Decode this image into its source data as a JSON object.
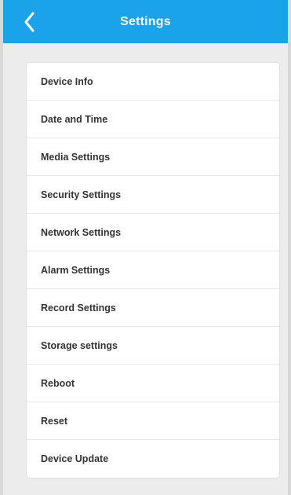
{
  "header": {
    "title": "Settings",
    "back_icon": "chevron-left-icon",
    "background_color": "#1aa3e8"
  },
  "menu": {
    "items": [
      {
        "label": "Device Info"
      },
      {
        "label": "Date and Time"
      },
      {
        "label": "Media Settings"
      },
      {
        "label": "Security Settings"
      },
      {
        "label": "Network Settings"
      },
      {
        "label": "Alarm Settings"
      },
      {
        "label": "Record Settings"
      },
      {
        "label": "Storage settings"
      },
      {
        "label": "Reboot"
      },
      {
        "label": "Reset"
      },
      {
        "label": "Device Update"
      }
    ]
  }
}
